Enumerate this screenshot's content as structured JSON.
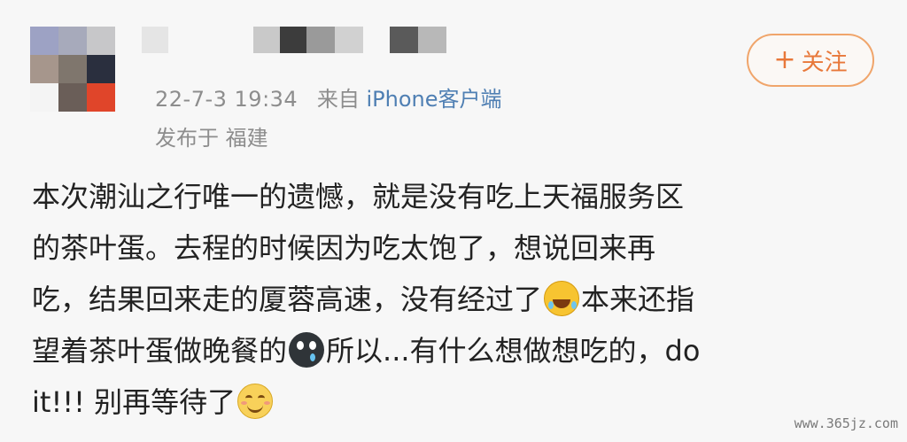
{
  "post": {
    "timestamp": "22-7-3 19:34",
    "source_prefix": "来自",
    "source_client": "iPhone客户端",
    "location": "发布于 福建",
    "follow_label": "关注",
    "content_lines": [
      "本次潮汕之行唯一的遗憾，就是没有吃上天福服务区",
      "的茶叶蛋。去程的时候因为吃太饱了，想说回来再",
      [
        "吃，结果回来走的厦蓉高速，没有经过了",
        "本来还指"
      ],
      [
        "望着茶叶蛋做晚餐的",
        "所以...有什么想做想吃的，do"
      ],
      [
        "it!!! 别再等待了",
        ""
      ]
    ]
  },
  "icons": {
    "follow": "plus-icon",
    "emoji_1": "laughing-crying-emoji-icon",
    "emoji_2": "sad-crying-emoji-icon",
    "emoji_3": "smiling-emoji-icon"
  },
  "watermark": "www.365jz.com",
  "colors": {
    "accent": "#e8783a",
    "link": "#4f7fb3",
    "meta": "#8d8d8d",
    "text": "#222222"
  }
}
